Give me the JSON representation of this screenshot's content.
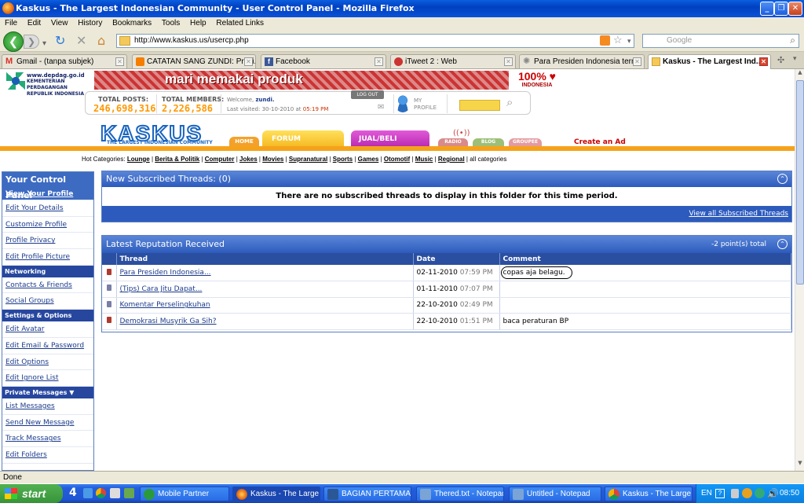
{
  "window": {
    "title": "Kaskus - The Largest Indonesian Community - User Control Panel - Mozilla Firefox"
  },
  "menu": [
    "File",
    "Edit",
    "View",
    "History",
    "Bookmarks",
    "Tools",
    "Help",
    "Related Links"
  ],
  "address": {
    "url": "http://www.kaskus.us/usercp.php",
    "search_placeholder": "Google"
  },
  "tabs": [
    {
      "label": "Gmail - (tanpa subjek)",
      "icon": "gmail-icon",
      "color": "#d93025"
    },
    {
      "label": "CATATAN SANG ZUNDI: Presi...",
      "icon": "blogger-icon",
      "color": "#f57d00"
    },
    {
      "label": "Facebook",
      "icon": "facebook-icon",
      "color": "#3b5998"
    },
    {
      "label": "iTweet 2 : Web",
      "icon": "itweet-icon",
      "color": "#c33"
    },
    {
      "label": "Para Presiden Indonesia tern...",
      "icon": "loading-icon",
      "color": "#888"
    },
    {
      "label": "Kaskus - The Largest Ind...",
      "icon": "kaskus-icon",
      "color": "#1a65c0",
      "active": true
    }
  ],
  "page": {
    "depdag": {
      "domain": "www.depdag.go.id",
      "name": "KEMENTERIAN PERDAGANGAN",
      "sub": "REPUBLIK INDONESIA"
    },
    "banner": {
      "text": "mari memakai produk",
      "badge": "100%",
      "badge_sub": "INDONESIA"
    },
    "stats": {
      "posts_label": "TOTAL POSTS:",
      "posts_value": "246,698,316",
      "members_label": "TOTAL MEMBERS:",
      "members_value": "2,226,586",
      "welcome": "Welcome,",
      "user": "zundi.",
      "last_visited_label": "Last visited:",
      "last_visited_date": "30-10-2010",
      "last_visited_time": "05:19 PM",
      "logout": "LOG OUT",
      "my_profile": "MY PROFILE"
    },
    "logo": {
      "title": "KASKUS",
      "tagline": "THE LARGEST INDONESIAN COMMUNITY"
    },
    "nav": {
      "home": "HOME",
      "forum": "FORUM",
      "jualbeli": "JUAL/BELI",
      "radio": "RADIO",
      "blog": "BLOG",
      "groupee": "GROUPEE",
      "create_ad": "Create an Ad"
    },
    "hot": {
      "label": "Hot Categories:",
      "items": [
        "Lounge",
        "Berita & Politik",
        "Computer",
        "Jokes",
        "Movies",
        "Supranatural",
        "Sports",
        "Games",
        "Otomotif",
        "Music",
        "Regional"
      ],
      "all": "all categories"
    },
    "sidebar": {
      "title": "Your Control Panel",
      "groups": [
        {
          "heading": "",
          "items": [
            "View Your Profile",
            "Edit Your Details",
            "Customize Profile",
            "Profile Privacy",
            "Edit Profile Picture"
          ]
        },
        {
          "heading": "Networking",
          "items": [
            "Contacts & Friends",
            "Social Groups"
          ]
        },
        {
          "heading": "Settings & Options",
          "items": [
            "Edit Avatar",
            "Edit Email & Password",
            "Edit Options",
            "Edit Ignore List"
          ]
        },
        {
          "heading": "Private Messages ▼",
          "items": [
            "List Messages",
            "Send New Message",
            "Track Messages",
            "Edit Folders"
          ]
        }
      ]
    },
    "subscribed": {
      "title": "New Subscribed Threads:",
      "count": "(0)",
      "message": "There are no subscribed threads to display in this folder for this time period.",
      "link": "View all Subscribed Threads"
    },
    "reputation": {
      "title": "Latest Reputation Received",
      "total": "-2 point(s) total",
      "columns": [
        "Thread",
        "Date",
        "Comment"
      ],
      "rows": [
        {
          "color": "#b03a2e",
          "thread": "Para Presiden Indonesia...",
          "date": "02-11-2010",
          "time": "07:59 PM",
          "comment": "copas aja belagu."
        },
        {
          "color": "#7a7fa6",
          "thread": "(Tips) Cara Jitu Dapat...",
          "date": "01-11-2010",
          "time": "07:07 PM",
          "comment": ""
        },
        {
          "color": "#7a7fa6",
          "thread": "Komentar Perselingkuhan",
          "date": "22-10-2010",
          "time": "02:49 PM",
          "comment": ""
        },
        {
          "color": "#b03a2e",
          "thread": "Demokrasi Musyrik Ga Sih?",
          "date": "22-10-2010",
          "time": "01:51 PM",
          "comment": "baca peraturan BP"
        }
      ]
    }
  },
  "status": "Done",
  "taskbar": {
    "start": "start",
    "quicklaunch": "4",
    "tasks": [
      {
        "label": "Mobile Partner",
        "color": "#2a9a3c"
      },
      {
        "label": "Kaskus - The Large...",
        "color": "#e86b10",
        "active": true
      },
      {
        "label": "BAGIAN PERTAMA....",
        "color": "#2b5797"
      },
      {
        "label": "Thered.txt - Notepad",
        "color": "#7aa4d6"
      },
      {
        "label": "Untitled - Notepad",
        "color": "#7aa4d6"
      },
      {
        "label": "Kaskus - The Large...",
        "color": "#e86b10"
      }
    ],
    "lang": "EN",
    "clock": "08:50"
  }
}
